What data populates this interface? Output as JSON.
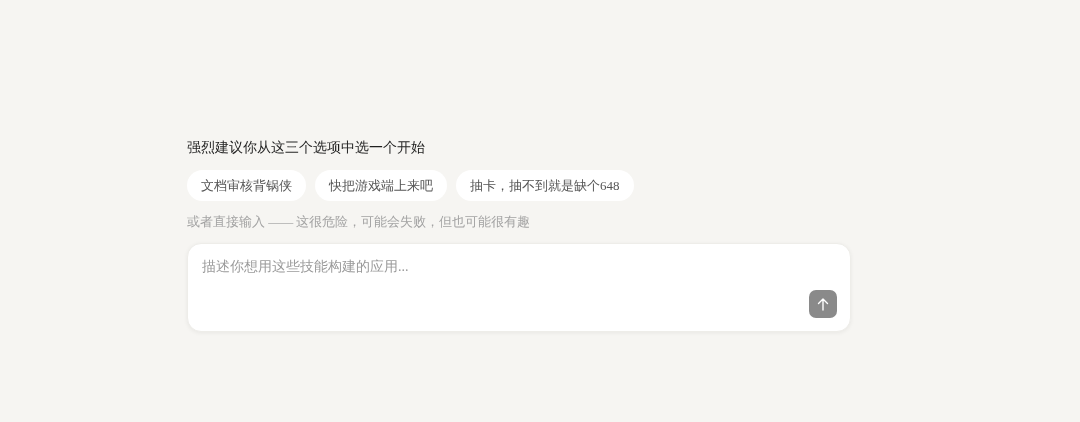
{
  "prompt": {
    "heading": "强烈建议你从这三个选项中选一个开始",
    "suggestions": [
      "文档审核背锅侠",
      "快把游戏端上来吧",
      "抽卡，抽不到就是缺个648"
    ],
    "hint": "或者直接输入 —— 这很危险，可能会失败，但也可能很有趣"
  },
  "composer": {
    "placeholder": "描述你想用这些技能构建的应用..."
  }
}
